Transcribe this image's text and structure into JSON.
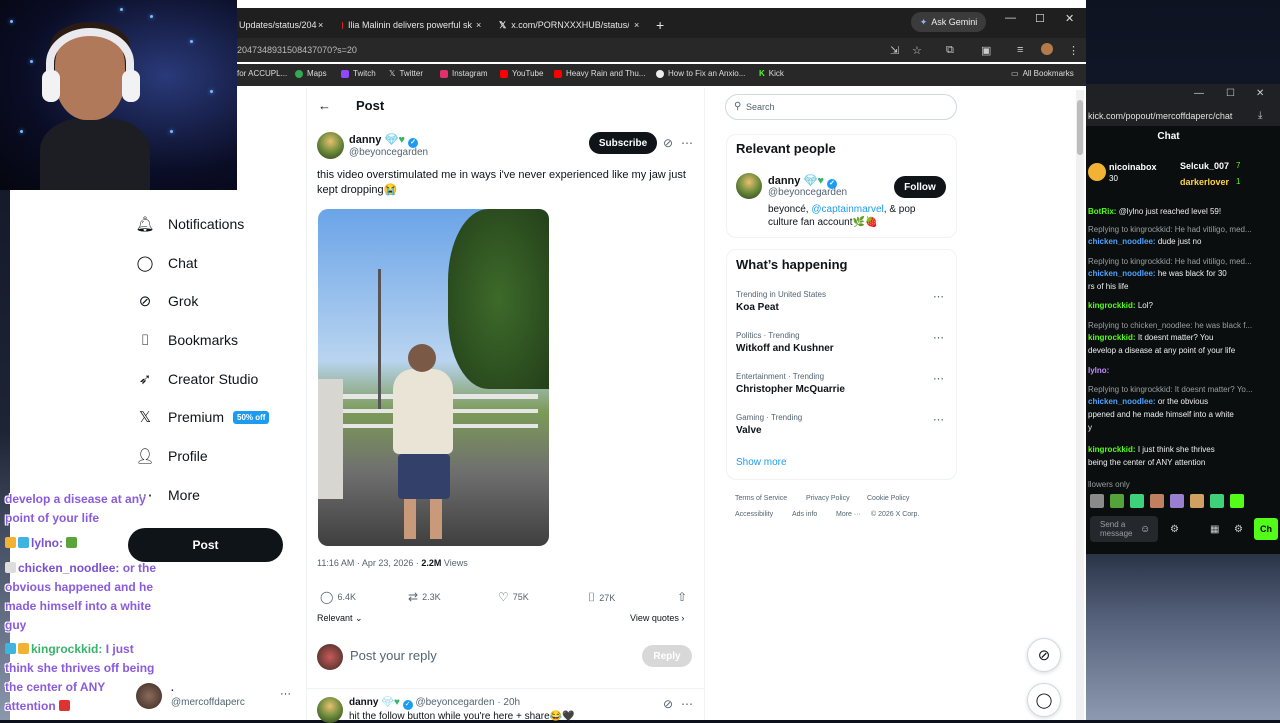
{
  "browser": {
    "tabs": [
      {
        "label": "Updates/status/204",
        "close": "×"
      },
      {
        "label": "Ilia Malinin delivers powerful sk",
        "close": "×"
      },
      {
        "label": "x.com/PORNXXXHUB/status/20",
        "close": "×"
      }
    ],
    "new_tab": "+",
    "ask_gemini": "Ask Gemini",
    "url": "2047348931508437070?s=20",
    "bookmarks": [
      "for ACCUPL...",
      "Maps",
      "Twitch",
      "Twitter",
      "Instagram",
      "YouTube",
      "Heavy Rain and Thu...",
      "How to Fix an Anxio...",
      "Kick"
    ],
    "all_bookmarks": "All Bookmarks"
  },
  "nav": {
    "items": [
      {
        "label": "Notifications",
        "icon": "bell-icon"
      },
      {
        "label": "Chat",
        "icon": "chat-icon"
      },
      {
        "label": "Grok",
        "icon": "grok-icon"
      },
      {
        "label": "Bookmarks",
        "icon": "bookmark-icon"
      },
      {
        "label": "Creator Studio",
        "icon": "rocket-icon"
      },
      {
        "label": "Premium",
        "icon": "x-logo-icon"
      },
      {
        "label": "Profile",
        "icon": "person-icon"
      },
      {
        "label": "More",
        "icon": "more-icon"
      }
    ],
    "premium_badge": "50% off",
    "post_button": "Post",
    "account_name": ".",
    "account_handle": "@mercoffdaperc",
    "account_more": "···"
  },
  "overlay_chat": {
    "line1": "develop a disease at any",
    "line2": "point of your life",
    "line3_user": "lylno:",
    "line4_user": "chicken_noodlee:",
    "line4_text": "or the",
    "line5": "obvious happened and he",
    "line6": "made himself into a white",
    "line7": "guy",
    "line8_user": "kingrockkid:",
    "line8_text": "I just",
    "line9": "think she thrives off being",
    "line10": "the center of ANY",
    "line11": "attention"
  },
  "post": {
    "header": "Post",
    "back": "←",
    "author_name": "danny",
    "author_handle": "@beyoncegarden",
    "subscribe": "Subscribe",
    "text": "this video overstimulated me in ways i've never experienced like my jaw just kept dropping😭",
    "time": "11:16 AM · Apr 23, 2026 · ",
    "views_count": "2.2M",
    "views_label": " Views",
    "replies": "6.4K",
    "reposts": "2.3K",
    "likes": "75K",
    "bookmarks": "27K",
    "relevant": "Relevant",
    "view_quotes": "View quotes",
    "reply_placeholder": "Post your reply",
    "reply_button": "Reply",
    "reply_author": "danny",
    "reply_handle": "@beyoncegarden · 20h",
    "reply_text": "hit the follow button while you're here + share😂🖤"
  },
  "sidebar": {
    "search_placeholder": "Search",
    "relevant_title": "Relevant people",
    "person_name": "danny",
    "person_handle": "@beyoncegarden",
    "follow": "Follow",
    "bio_pre": "beyoncé, ",
    "bio_link": "@captainmarvel",
    "bio_post": ", & pop culture fan account🌿🍓",
    "happening_title": "What’s happening",
    "trends": [
      {
        "context": "Trending in United States",
        "name": "Koa Peat"
      },
      {
        "context": "Politics · Trending",
        "name": "Witkoff and Kushner"
      },
      {
        "context": "Entertainment · Trending",
        "name": "Christopher McQuarrie"
      },
      {
        "context": "Gaming · Trending",
        "name": "Valve"
      }
    ],
    "show_more": "Show more",
    "footer": [
      "Terms of Service",
      "Privacy Policy",
      "Cookie Policy",
      "Accessibility",
      "Ads info",
      "More ···",
      "© 2026 X Corp."
    ]
  },
  "kick": {
    "url": "kick.com/popout/mercoffdaperc/chat",
    "title": "Chat",
    "top_users": [
      {
        "name": "nicoinabox",
        "count": "30"
      },
      {
        "name": "Selcuk_007",
        "count": "7"
      },
      {
        "name": "darkerlover",
        "count": "1"
      }
    ],
    "messages": [
      {
        "user": "BotRix:",
        "text": "@lylno just reached level 59!"
      },
      {
        "reply": "Replying to kingrockkid: He had vitiligo, med..."
      },
      {
        "user": "chicken_noodlee:",
        "text": "dude just no"
      },
      {
        "reply": "Replying to kingrockkid: He had vitiligo, med..."
      },
      {
        "user": "chicken_noodlee:",
        "text": "he was black for 30"
      },
      {
        "text": "rs of his life"
      },
      {
        "user": "kingrockkid:",
        "text": "Lol?"
      },
      {
        "reply": "Replying to chicken_noodlee: he was black f..."
      },
      {
        "user": "kingrockkid:",
        "text": "It doesnt matter? You"
      },
      {
        "text": "develop a disease at any point of your life"
      },
      {
        "user": "lylno:",
        "text": ""
      },
      {
        "reply": "Replying to kingrockkid: It doesnt matter? Yo..."
      },
      {
        "user": "chicken_noodlee:",
        "text": "or the obvious"
      },
      {
        "text": "ppened and he made himself into a white"
      },
      {
        "text": "y"
      },
      {
        "user": "kingrockkid:",
        "text": "I just think she thrives"
      },
      {
        "text": "being the center of ANY attention"
      },
      {
        "text": "llowers only"
      }
    ],
    "input_placeholder": "Send a message",
    "send": "Ch"
  },
  "colors": {
    "x_blue": "#1d9bf0",
    "kick_green": "#53fc18",
    "overlay_purple": "#8a5bdc"
  }
}
